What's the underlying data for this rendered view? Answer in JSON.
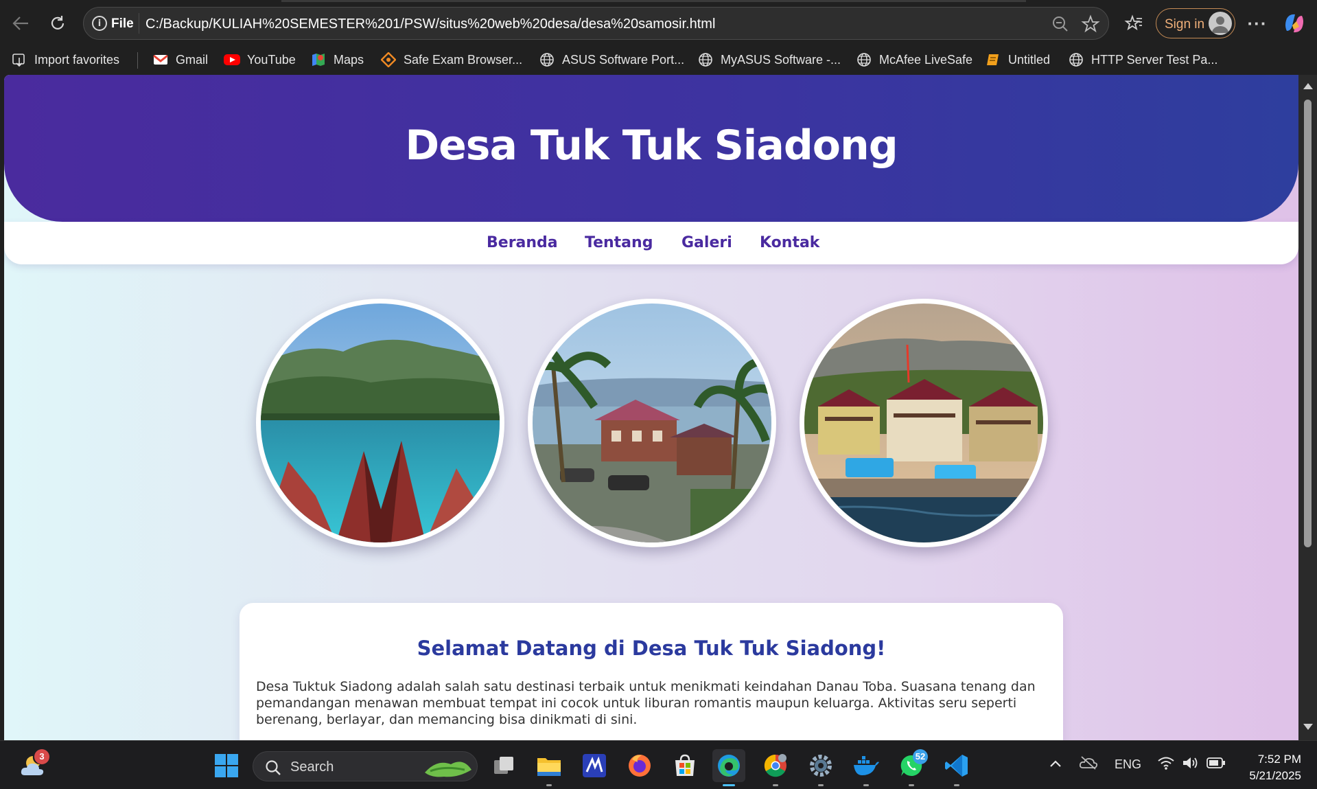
{
  "browser": {
    "address": {
      "scheme_label": "File",
      "url": "C:/Backup/KULIAH%20SEMESTER%201/PSW/situs%20web%20desa/desa%20samosir.html"
    },
    "signin_label": "Sign in",
    "favorites": [
      {
        "label": "Import favorites",
        "icon": "import-icon"
      },
      {
        "label": "Gmail",
        "icon": "gmail-icon"
      },
      {
        "label": "YouTube",
        "icon": "youtube-icon"
      },
      {
        "label": "Maps",
        "icon": "maps-icon"
      },
      {
        "label": "Safe Exam Browser...",
        "icon": "seb-icon"
      },
      {
        "label": "ASUS Software Port...",
        "icon": "globe-icon"
      },
      {
        "label": "MyASUS Software -...",
        "icon": "globe-icon"
      },
      {
        "label": "McAfee LiveSafe",
        "icon": "globe-icon"
      },
      {
        "label": "Untitled",
        "icon": "note-icon"
      },
      {
        "label": "HTTP Server Test Pa...",
        "icon": "globe-icon"
      }
    ]
  },
  "site": {
    "title": "Desa Tuk Tuk Siadong",
    "nav": [
      "Beranda",
      "Tentang",
      "Galeri",
      "Kontak"
    ],
    "gallery": [
      "lake-mountain-photo",
      "village-resort-photo",
      "lakeside-hotel-photo"
    ],
    "welcome_title": "Selamat Datang di Desa Tuk Tuk Siadong!",
    "welcome_text": "Desa Tuktuk Siadong adalah salah satu destinasi terbaik untuk menikmati keindahan Danau Toba. Suasana tenang dan pemandangan menawan membuat tempat ini cocok untuk liburan romantis maupun keluarga. Aktivitas seru seperti berenang, berlayar, dan memancing bisa dinikmati di sini.",
    "colors": {
      "hero_start": "#4a2b9e",
      "hero_end": "#2e3e9e",
      "nav_link": "#4a2aa0",
      "welcome_title": "#2b3a9e"
    }
  },
  "taskbar": {
    "weather_badge": "3",
    "search_label": "Search",
    "whatsapp_badge": "52",
    "language": "ENG",
    "time": "7:52 PM",
    "date": "5/21/2025"
  }
}
